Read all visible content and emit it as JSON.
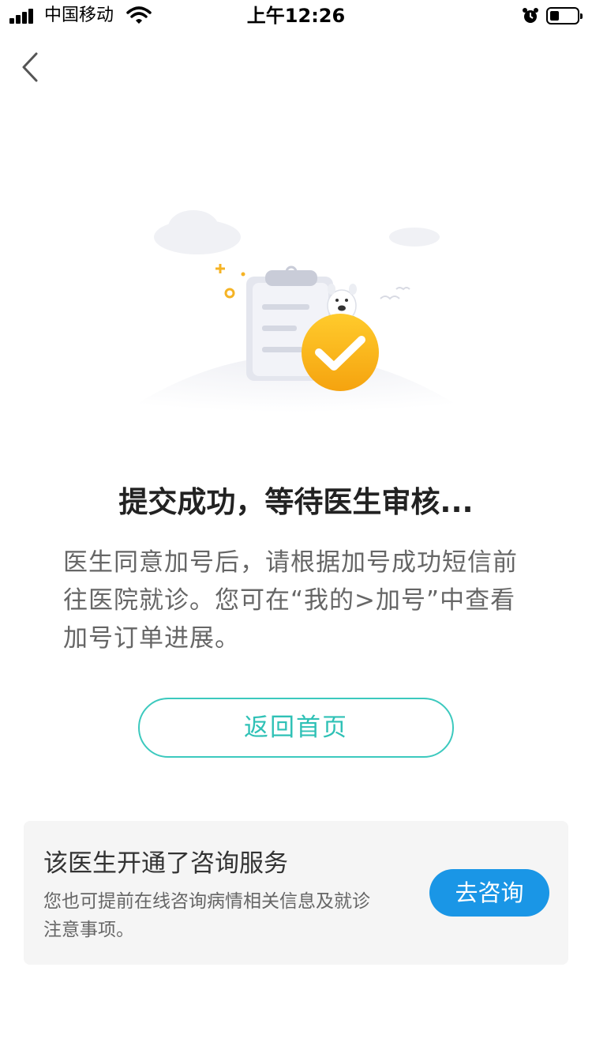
{
  "status_bar": {
    "carrier": "中国移动",
    "time": "上午12:26",
    "signal_bars": 4,
    "battery_level": 0.35
  },
  "nav": {
    "back_icon": "chevron-left-icon"
  },
  "illustration": {
    "icon": "submission-success-illustration",
    "accent_color": "#f7b91b"
  },
  "main": {
    "title": "提交成功，等待医生审核...",
    "description": "医生同意加号后，请根据加号成功短信前往医院就诊。您可在“我的>加号”中查看加号订单进展。",
    "home_button": "返回首页"
  },
  "consult_card": {
    "title": "该医生开通了咨询服务",
    "description": "您也可提前在线咨询病情相关信息及就诊注意事项。",
    "button": "去咨询"
  },
  "colors": {
    "teal": "#2fc1b6",
    "blue": "#1a96e6",
    "card_bg": "#f5f5f5"
  }
}
